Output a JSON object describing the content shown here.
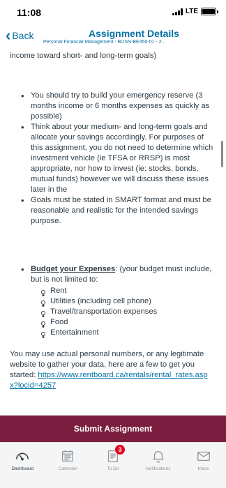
{
  "status_bar": {
    "time": "11:08",
    "network": "LTE"
  },
  "nav": {
    "back_label": "Back",
    "title": "Assignment Details",
    "subtitle": "Personal Financial Management - BUSN-BE450-01 - 2..."
  },
  "content": {
    "cut_line": "income toward short- and long-term goals)",
    "goals_bullets": [
      "You should try to build your emergency reserve (3 months income or 6 months expenses as quickly as possible)",
      "Think about your medium- and long-term goals and allocate your savings accordingly. For purposes of this assignment, you do not need to determine which investment vehicle (ie TFSA or RRSP) is most appropriate, nor how to invest (ie: stocks, bonds, mutual funds) however we will discuss these issues later in the",
      "Goals must be stated in SMART format and must be reasonable and realistic for the intended savings purpose."
    ],
    "budget": {
      "heading": "Budget your Expenses",
      "intro": ": (your budget must include, but is not limited to:",
      "items": [
        "Rent",
        "Utilities (including cell phone)",
        "Travel/transportation expenses",
        "Food",
        "Entertainment"
      ]
    },
    "closing_text": "You may use actual personal numbers, or any legitimate website to gather your data, here are a few to get you started:",
    "link": "https://www.rentboard.ca/rentals/rental_rates.aspx?locid=4257"
  },
  "submit_label": "Submit Assignment",
  "tabs": [
    {
      "label": "Dashboard",
      "icon": "dashboard-icon"
    },
    {
      "label": "Calendar",
      "icon": "calendar-icon"
    },
    {
      "label": "To Do",
      "icon": "todo-icon",
      "badge": "3"
    },
    {
      "label": "Notifications",
      "icon": "bell-icon"
    },
    {
      "label": "Inbox",
      "icon": "inbox-icon"
    }
  ],
  "colors": {
    "accent": "#0770a3",
    "submit_bg": "#7a1d3f",
    "badge": "#e0061f"
  }
}
